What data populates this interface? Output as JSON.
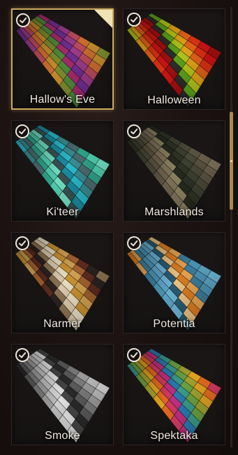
{
  "palettes": [
    {
      "name": "Hallow's Eve",
      "selected": true,
      "checked": true,
      "colors": [
        "#6f2e8f",
        "#9a3b8a",
        "#b84a5c",
        "#c86d2e",
        "#c38a2d",
        "#7c8a2e",
        "#4e8a3a",
        "#a52b6c"
      ]
    },
    {
      "name": "Halloween",
      "selected": false,
      "checked": true,
      "colors": [
        "#b0c21a",
        "#e0a018",
        "#e0601a",
        "#d83014",
        "#c81414",
        "#a01010",
        "#2c2c2c",
        "#5aa01a"
      ]
    },
    {
      "name": "Ki'teer",
      "selected": false,
      "checked": true,
      "colors": [
        "#2ab8c8",
        "#3a8a90",
        "#4a6a6e",
        "#2ea088",
        "#4fc8aa",
        "#6fdcc0",
        "#3a5050",
        "#1a8aa0"
      ]
    },
    {
      "name": "Marshlands",
      "selected": false,
      "checked": true,
      "colors": [
        "#2e3324",
        "#3c4030",
        "#4a4838",
        "#5a5240",
        "#6a5f4a",
        "#7c7058",
        "#8a8060",
        "#262a1e"
      ]
    },
    {
      "name": "Narmer",
      "selected": false,
      "checked": true,
      "colors": [
        "#c89030",
        "#d0a050",
        "#a06030",
        "#5a2a20",
        "#2a2220",
        "#8a7050",
        "#d8c8a8",
        "#e8dcc0"
      ]
    },
    {
      "name": "Potentia",
      "selected": false,
      "checked": true,
      "colors": [
        "#d87a20",
        "#e0a050",
        "#3a7a9a",
        "#4a90b0",
        "#5aa0c0",
        "#6ab0d0",
        "#2a5a70",
        "#e8c080"
      ]
    },
    {
      "name": "Smoke",
      "selected": false,
      "checked": true,
      "colors": [
        "#2a2a2a",
        "#5a5a5a",
        "#7a7a7a",
        "#9a9a9a",
        "#b8b8b8",
        "#d0d0d0",
        "#e0e0e0",
        "#444444"
      ]
    },
    {
      "name": "Spektaka",
      "selected": false,
      "checked": true,
      "colors": [
        "#3a9a8a",
        "#6aa040",
        "#a0a030",
        "#e0a020",
        "#e06a20",
        "#d03a60",
        "#c03080",
        "#2a7ab0"
      ]
    }
  ],
  "scrollbar": {
    "position_fraction": 0.24
  }
}
